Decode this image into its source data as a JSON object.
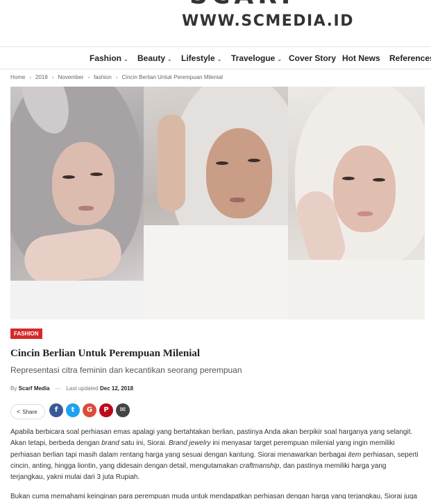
{
  "header": {
    "logo_text": "SCARF",
    "logo_url": "WWW.SCMEDIA.ID"
  },
  "nav": {
    "items": [
      {
        "label": "Fashion",
        "has_dropdown": true
      },
      {
        "label": "Beauty",
        "has_dropdown": true
      },
      {
        "label": "Lifestyle",
        "has_dropdown": true
      },
      {
        "label": "Travelogue",
        "has_dropdown": true
      },
      {
        "label": "Cover Story",
        "has_dropdown": false
      },
      {
        "label": "Hot News",
        "has_dropdown": false
      },
      {
        "label": "References",
        "has_dropdown": false
      }
    ],
    "chevron": "⌄"
  },
  "breadcrumb": {
    "items": [
      "Home",
      "2018",
      "November",
      "fashion",
      "Cincin Berlian Untuk Perempuan Milenial"
    ],
    "separator": "›"
  },
  "article": {
    "category": "FASHION",
    "category_color": "#d42a2a",
    "title": "Cincin Berlian Untuk Perempuan Milenial",
    "subtitle": "Representasi citra feminin dan kecantikan seorang perempuan",
    "by_label": "By",
    "author": "Scarf Media",
    "dash": "—",
    "updated_label": "Last updated",
    "updated_date": "Dec 12, 2018"
  },
  "share": {
    "label": "Share",
    "icon": "share-icon",
    "buttons": [
      {
        "name": "facebook",
        "glyph": "f",
        "color": "#3b5998"
      },
      {
        "name": "twitter",
        "glyph": "t",
        "color": "#1da1f2"
      },
      {
        "name": "google-plus",
        "glyph": "G",
        "color": "#dd4b39"
      },
      {
        "name": "pinterest",
        "glyph": "P",
        "color": "#bd081c"
      },
      {
        "name": "email",
        "glyph": "✉",
        "color": "#444444"
      }
    ]
  },
  "body": {
    "p1": [
      {
        "t": "Apabila berbicara soal perhiasan emas apalagi yang bertahtakan berlian, pastinya Anda akan berpikir soal harganya yang selangit. Akan tetapi, berbeda dengan ",
        "i": false
      },
      {
        "t": "brand",
        "i": true
      },
      {
        "t": " satu ini, Siorai. ",
        "i": false
      },
      {
        "t": "Brand jewelry",
        "i": true
      },
      {
        "t": " ini menyasar target perempuan milenial yang ingin memiliki perhiasan berlian tapi masih dalam rentang harga yang sesuai dengan kantung. Siorai menawarkan berbagai ",
        "i": false
      },
      {
        "t": "item",
        "i": true
      },
      {
        "t": " perhiasan, seperti cincin, anting, hingga liontin, yang didesain dengan detail, mengutamakan ",
        "i": false
      },
      {
        "t": "craftmanship",
        "i": true
      },
      {
        "t": ", dan pastinya memiliki harga yang terjangkau, yakni mulai dari 3 juta Rupiah.",
        "i": false
      }
    ],
    "p2": "Bukan cuma memahami keinginan para perempuan muda untuk mendapatkan perhiasan dengan harga yang terjangkau, Siorai juga"
  }
}
